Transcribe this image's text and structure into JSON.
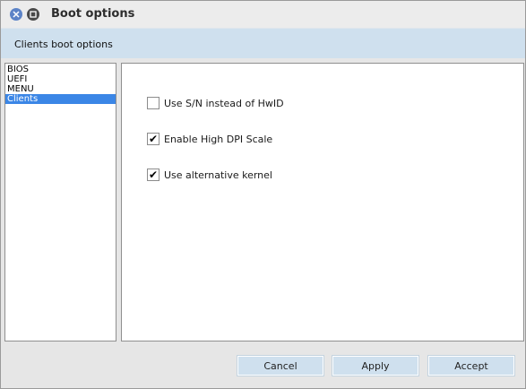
{
  "window": {
    "title": "Boot options"
  },
  "header": {
    "label": "Clients boot options"
  },
  "sidebar": {
    "items": [
      {
        "label": "BIOS",
        "selected": false
      },
      {
        "label": "UEFI",
        "selected": false
      },
      {
        "label": "MENU",
        "selected": false
      },
      {
        "label": "Clients",
        "selected": true
      }
    ]
  },
  "options": [
    {
      "label": "Use S/N instead of HwID",
      "checked": false
    },
    {
      "label": "Enable High DPI Scale",
      "checked": true
    },
    {
      "label": "Use alternative kernel",
      "checked": true
    }
  ],
  "buttons": {
    "cancel": "Cancel",
    "apply": "Apply",
    "accept": "Accept"
  },
  "colors": {
    "header_band": "#cfe0ee",
    "selection": "#3b86e6",
    "close_button": "#5c83c7"
  }
}
